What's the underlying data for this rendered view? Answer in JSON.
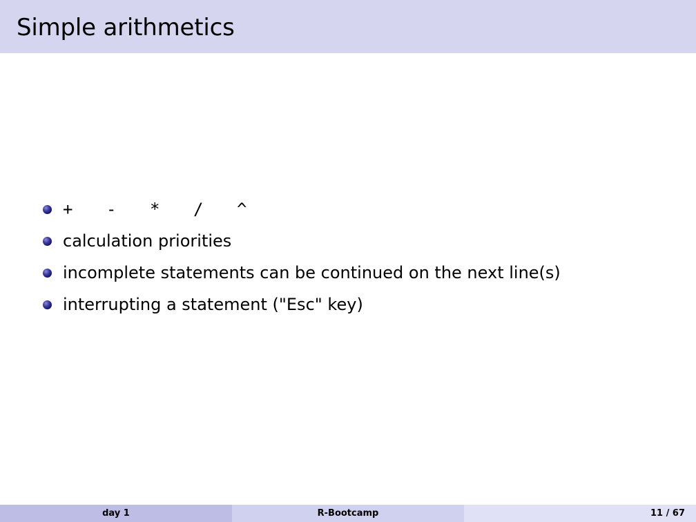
{
  "slide": {
    "title": "Simple arithmetics",
    "bullets": {
      "operators": [
        "+",
        "-",
        "*",
        "/",
        "^"
      ],
      "items": [
        "calculation priorities",
        "incomplete statements can be continued on the next line(s)",
        "interrupting a statement (\"Esc\" key)"
      ]
    }
  },
  "footer": {
    "left": "day 1",
    "center": "R-Bootcamp",
    "right": "11 / 67"
  }
}
